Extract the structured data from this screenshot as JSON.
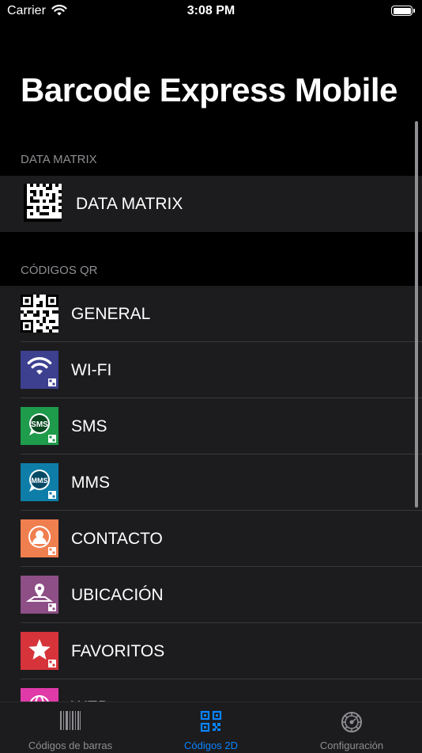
{
  "status_bar": {
    "carrier": "Carrier",
    "time": "3:08 PM"
  },
  "title": "Barcode Express Mobile",
  "sections": [
    {
      "header": "DATA MATRIX",
      "items": [
        {
          "label": "DATA MATRIX",
          "icon": "data-matrix-icon"
        }
      ]
    },
    {
      "header": "CÓDIGOS QR",
      "items": [
        {
          "label": "GENERAL",
          "icon": "qr-code-icon"
        },
        {
          "label": "WI-FI",
          "icon": "wifi-qr-icon",
          "color": "#3d3f8f"
        },
        {
          "label": "SMS",
          "icon": "sms-qr-icon",
          "color": "#1e9b4b"
        },
        {
          "label": "MMS",
          "icon": "mms-qr-icon",
          "color": "#0e7ea8"
        },
        {
          "label": "CONTACTO",
          "icon": "contact-qr-icon",
          "color": "#f07f4f"
        },
        {
          "label": "UBICACIÓN",
          "icon": "location-qr-icon",
          "color": "#8d4f86"
        },
        {
          "label": "FAVORITOS",
          "icon": "favorites-qr-icon",
          "color": "#d6333a"
        },
        {
          "label": "WEB",
          "icon": "web-qr-icon",
          "color": "#e03aa9"
        }
      ]
    }
  ],
  "tab_bar": {
    "tabs": [
      {
        "label": "Códigos de barras",
        "icon": "barcode-icon",
        "active": false
      },
      {
        "label": "Códigos 2D",
        "icon": "qr-code-icon",
        "active": true
      },
      {
        "label": "Configuración",
        "icon": "gear-icon",
        "active": false
      }
    ]
  },
  "colors": {
    "accent": "#0a84ff",
    "background": "#000000",
    "cell": "#1c1c1e",
    "section_text": "#8e8e93"
  }
}
